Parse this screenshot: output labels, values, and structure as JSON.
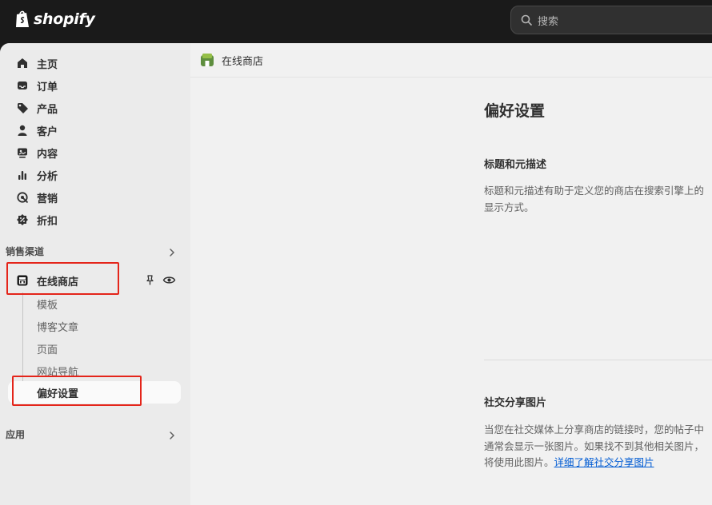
{
  "topbar": {
    "logo_text": "shopify",
    "search_placeholder": "搜索"
  },
  "sidebar": {
    "main_items": [
      {
        "label": "主页",
        "icon": "home-icon"
      },
      {
        "label": "订单",
        "icon": "inbox-icon"
      },
      {
        "label": "产品",
        "icon": "tag-icon"
      },
      {
        "label": "客户",
        "icon": "person-icon"
      },
      {
        "label": "内容",
        "icon": "image-icon"
      },
      {
        "label": "分析",
        "icon": "bar-chart-icon"
      },
      {
        "label": "营销",
        "icon": "target-icon"
      },
      {
        "label": "折扣",
        "icon": "discount-icon"
      }
    ],
    "sales_channels_title": "销售渠道",
    "online_store": {
      "label": "在线商店",
      "sub_items": [
        "模板",
        "博客文章",
        "页面",
        "网站导航",
        "偏好设置"
      ]
    },
    "apps_title": "应用"
  },
  "breadcrumb": {
    "label": "在线商店"
  },
  "main": {
    "page_title": "偏好设置",
    "sections": [
      {
        "heading": "标题和元描述",
        "description": "标题和元描述有助于定义您的商店在搜索引擎上的显示方式。"
      },
      {
        "heading": "社交分享图片",
        "description": "当您在社交媒体上分享商店的链接时，您的帖子中通常会显示一张图片。如果找不到其他相关图片，将使用此图片。",
        "link_text": "详细了解社交分享图片"
      }
    ]
  },
  "colors": {
    "topbar_bg": "#1a1a1a",
    "sidebar_bg": "#ebebeb",
    "content_bg": "#f1f1f1",
    "highlight_box": "#e4251a",
    "link": "#005bd3"
  }
}
